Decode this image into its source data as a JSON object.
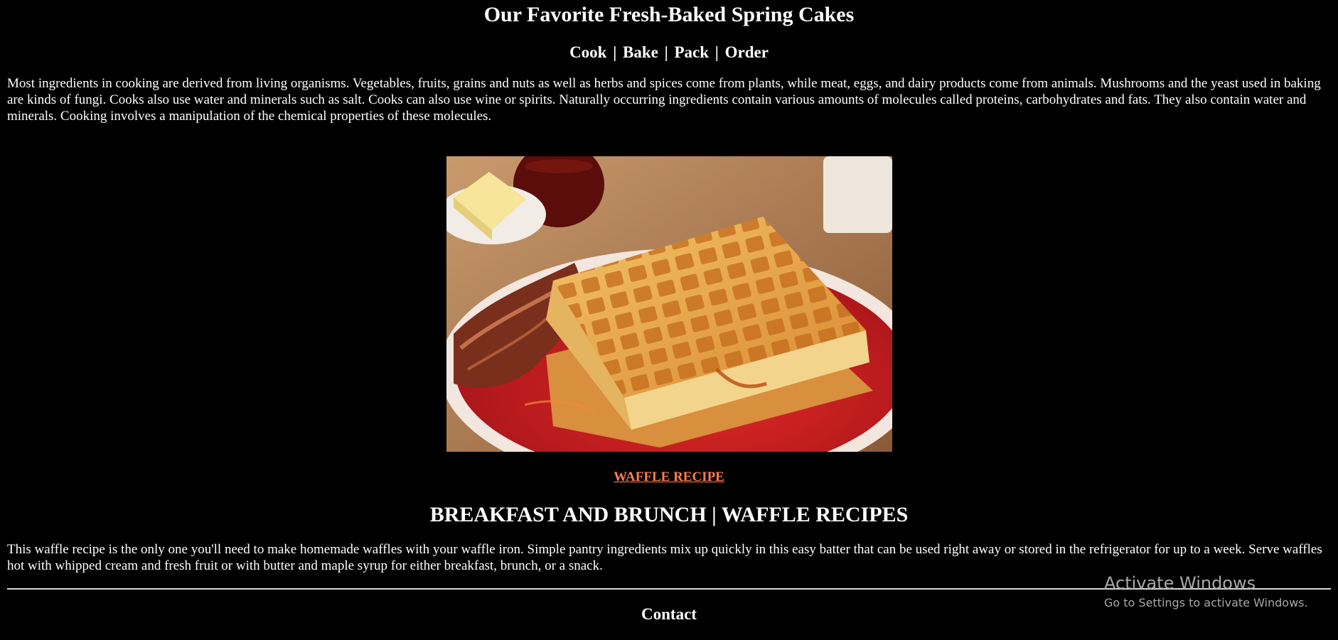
{
  "header": {
    "title": "Our Favorite Fresh-Baked Spring Cakes",
    "nav": [
      "Cook",
      "Bake",
      "Pack",
      "Order"
    ],
    "nav_separator": "|"
  },
  "intro": {
    "text": "Most ingredients in cooking are derived from living organisms. Vegetables, fruits, grains and nuts as well as herbs and spices come from plants, while meat, eggs, and dairy products come from animals. Mushrooms and the yeast used in baking are kinds of fungi. Cooks also use water and minerals such as salt. Cooks can also use wine or spirits. Naturally occurring ingredients contain various amounts of molecules called proteins, carbohydrates and fats. They also contain water and minerals. Cooking involves a manipulation of the chemical properties of these molecules."
  },
  "hero": {
    "icon": "waffle-photo"
  },
  "recipe": {
    "link_label": "WAFFLE RECIPE",
    "link_color": "#ff7f50",
    "section_title": "BREAKFAST AND BRUNCH | WAFFLE RECIPES",
    "description": "This waffle recipe is the only one you'll need to make homemade waffles with your waffle iron. Simple pantry ingredients mix up quickly in this easy batter that can be used right away or stored in the refrigerator for up to a week. Serve waffles hot with whipped cream and fresh fruit or with butter and maple syrup for either breakfast, brunch, or a snack."
  },
  "footer": {
    "contact_label": "Contact"
  },
  "watermark": {
    "title": "Activate Windows",
    "subtitle": "Go to Settings to activate Windows."
  }
}
